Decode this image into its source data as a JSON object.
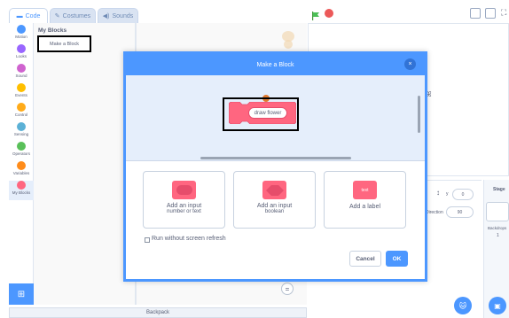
{
  "tabs": [
    {
      "label": "Code",
      "icon": "code-icon"
    },
    {
      "label": "Costumes",
      "icon": "brush-icon"
    },
    {
      "label": "Sounds",
      "icon": "speaker-icon"
    }
  ],
  "categories": [
    {
      "label": "Motion",
      "color": "#4c97ff"
    },
    {
      "label": "Looks",
      "color": "#9966ff"
    },
    {
      "label": "Sound",
      "color": "#cf63cf"
    },
    {
      "label": "Events",
      "color": "#ffbf00"
    },
    {
      "label": "Control",
      "color": "#ffab19"
    },
    {
      "label": "Sensing",
      "color": "#5cb1d6"
    },
    {
      "label": "Operators",
      "color": "#59c059"
    },
    {
      "label": "Variables",
      "color": "#ff8c1a"
    },
    {
      "label": "My Blocks",
      "color": "#ff6680"
    }
  ],
  "palette": {
    "title": "My Blocks",
    "make_block_label": "Make a Block"
  },
  "zoom_label": "=",
  "backpack_label": "Backpack",
  "dialog": {
    "title": "Make a Block",
    "close_glyph": "×",
    "block_name": "draw flower",
    "block_color": "#ff6680",
    "options": [
      {
        "title": "Add an input",
        "subtitle": "number or text"
      },
      {
        "title": "Add an input",
        "subtitle": "boolean"
      },
      {
        "title": "Add a label",
        "subtitle": "",
        "badge": "text"
      }
    ],
    "checkbox_label": "Run without screen refresh",
    "cancel_label": "Cancel",
    "ok_label": "OK"
  },
  "sprite_info": {
    "y_label": "y",
    "y_value": "0",
    "direction_label": "Direction",
    "direction_value": "90"
  },
  "stage_panel": {
    "title": "Stage",
    "backdrops_label": "Backdrops",
    "backdrops_count": "1"
  },
  "colors": {
    "accent": "#4c97ff",
    "myblocks": "#ff6680"
  }
}
